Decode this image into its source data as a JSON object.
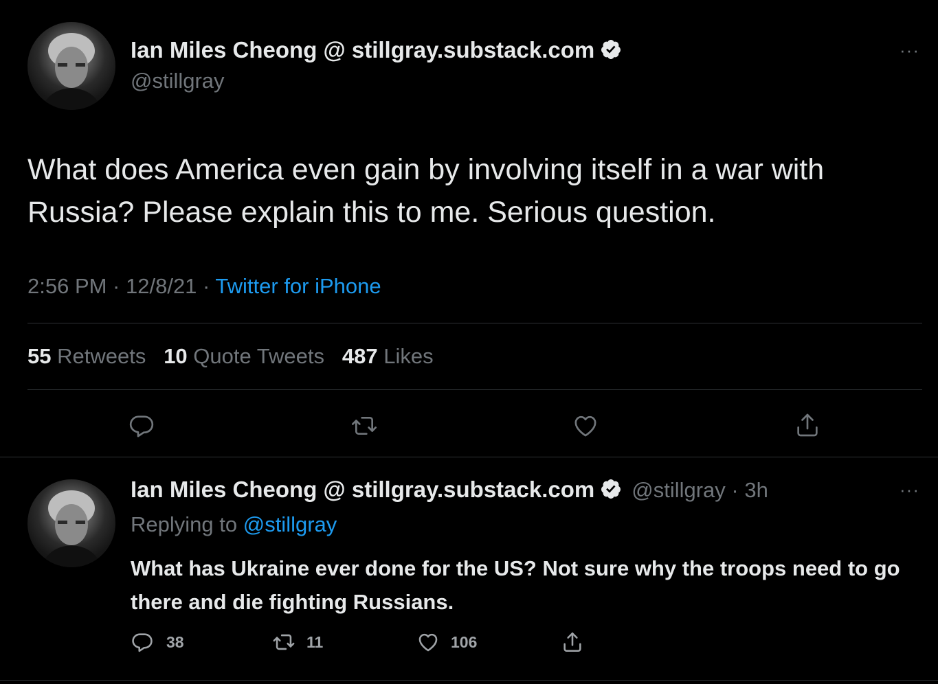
{
  "main_tweet": {
    "author_name": "Ian Miles Cheong @ stillgray.substack.com",
    "author_handle": "@stillgray",
    "more_label": "···",
    "text": "What does America even gain by involving itself in a war with Russia? Please explain this to me. Serious question.",
    "time": "2:56 PM · 12/8/21 · ",
    "source": "Twitter for iPhone",
    "retweets_count": "55",
    "retweets_label": "Retweets",
    "quotes_count": "10",
    "quotes_label": "Quote Tweets",
    "likes_count": "487",
    "likes_label": "Likes",
    "actions": [
      "reply-icon",
      "retweet-icon",
      "like-icon",
      "share-icon"
    ]
  },
  "reply_tweet": {
    "author_name": "Ian Miles Cheong @ stillgray.substack.com",
    "author_handle": "@stillgray",
    "time_ago": " · 3h",
    "more_label": "···",
    "replying_to_label": "Replying to ",
    "replying_to_handle": "@stillgray",
    "text": "What has Ukraine ever done for the US? Not sure why the troops need to go there and die fighting Russians.",
    "reply_count": "38",
    "retweet_count": "11",
    "like_count": "106"
  },
  "colors": {
    "background": "#000000",
    "text": "#e7e9ea",
    "secondary": "#71767b",
    "accent": "#1d9bf0",
    "divider": "#2f3336"
  }
}
